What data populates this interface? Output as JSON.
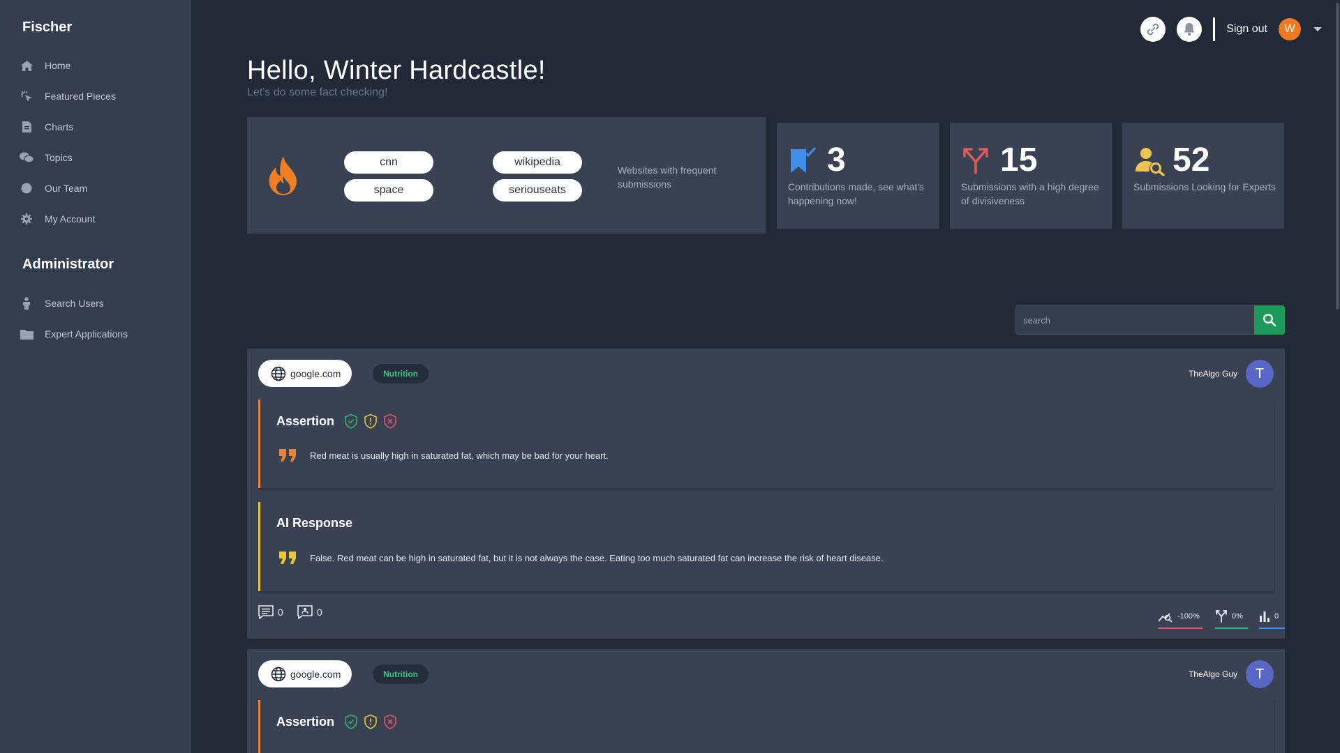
{
  "colors": {
    "background": "#222a38",
    "sidebar": "#343d4e",
    "card": "#394253",
    "accent_green": "#1c9a5c",
    "avatar_orange": "#ef7a22",
    "author_avatar": "#5a68c5",
    "assertion_border": "#e8833a",
    "ai_border": "#e9c53b",
    "tag_text": "#3fc28d"
  },
  "sidebar": {
    "brand": "Fischer",
    "items": [
      {
        "label": "Home",
        "icon": "home-icon"
      },
      {
        "label": "Featured Pieces",
        "icon": "pointer-icon"
      },
      {
        "label": "Charts",
        "icon": "document-icon"
      },
      {
        "label": "Topics",
        "icon": "chat-bubbles-icon"
      },
      {
        "label": "Our Team",
        "icon": "circle-icon"
      },
      {
        "label": "My Account",
        "icon": "gear-icon"
      }
    ],
    "admin_title": "Administrator",
    "admin_items": [
      {
        "label": "Search Users",
        "icon": "person-icon"
      },
      {
        "label": "Expert Applications",
        "icon": "folder-icon"
      }
    ]
  },
  "header": {
    "sign_out": "Sign out",
    "avatar_initial": "W"
  },
  "main": {
    "greeting": "Hello, Winter Hardcastle!",
    "subtitle": "Let's do some fact checking!",
    "sites": [
      "cnn",
      "space",
      "wikipedia",
      "seriouseats"
    ],
    "sites_description": "Websites with frequent submissions",
    "stats": [
      {
        "value": "3",
        "description": "Contributions made, see what's happening now!",
        "icon": "bookmark-check-icon"
      },
      {
        "value": "15",
        "description": "Submissions with a high degree of divisiveness",
        "icon": "split-arrows-icon"
      },
      {
        "value": "52",
        "description": "Submissions Looking for Experts",
        "icon": "user-search-icon"
      }
    ],
    "search_placeholder": "search"
  },
  "posts": [
    {
      "source": "google.com",
      "tag": "Nutrition",
      "author": "TheAlgo Guy",
      "author_initial": "T",
      "assertion_title": "Assertion",
      "assertion_text": "Red meat is usually high in saturated fat, which may be bad for your heart.",
      "ai_title": "AI Response",
      "ai_text": "False. Red meat can be high in saturated fat, but it is not always the case. Eating too much saturated fat can increase the risk of heart disease.",
      "comments": "0",
      "replies": "0",
      "trend": "-100%",
      "divisiveness": "0%",
      "votes": "0"
    },
    {
      "source": "google.com",
      "tag": "Nutrition",
      "author": "TheAlgo Guy",
      "author_initial": "T",
      "assertion_title": "Assertion"
    }
  ]
}
